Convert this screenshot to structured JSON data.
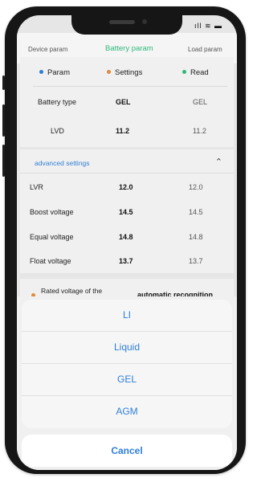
{
  "status_bar": {
    "icons": "signal-wifi-battery",
    "text": "ıll ≋ ▬"
  },
  "tabs": [
    {
      "label": "Device param"
    },
    {
      "label": "Battery param"
    },
    {
      "label": "Load param"
    }
  ],
  "legend": {
    "param": {
      "label": "Param",
      "color": "#2f7fd6"
    },
    "settings": {
      "label": "Settings",
      "color": "#e08a3c"
    },
    "read": {
      "label": "Read",
      "color": "#2fb87b"
    }
  },
  "basic_rows": [
    {
      "name": "Battery type",
      "setting": "GEL",
      "read": "GEL"
    },
    {
      "name": "LVD",
      "setting": "11.2",
      "read": "11.2"
    }
  ],
  "advanced": {
    "title": "advanced settings",
    "chevron_icon": "chevron-up-double-icon",
    "rows": [
      {
        "name": "LVR",
        "setting": "12.0",
        "read": "12.0"
      },
      {
        "name": "Boost voltage",
        "setting": "14.5",
        "read": "14.5"
      },
      {
        "name": "Equal voltage",
        "setting": "14.8",
        "read": "14.8"
      },
      {
        "name": "Float voltage",
        "setting": "13.7",
        "read": "13.7"
      }
    ]
  },
  "rated_voltage": {
    "label": "Rated voltage of the system",
    "value": "automatic recognition",
    "dot_color": "#e08a3c"
  },
  "action_sheet": {
    "options": [
      "LI",
      "Liquid",
      "GEL",
      "AGM"
    ],
    "cancel": "Cancel"
  }
}
